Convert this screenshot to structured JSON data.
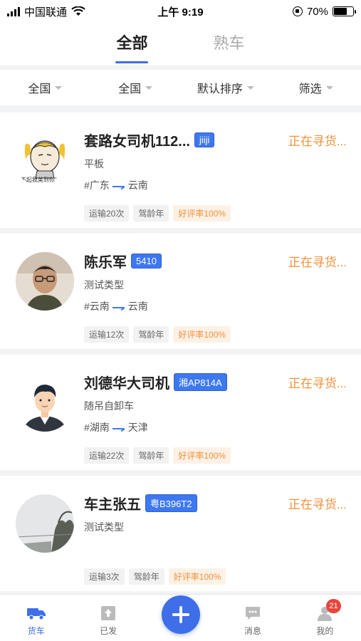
{
  "status_bar": {
    "carrier": "中国联通",
    "time": "上午 9:19",
    "battery": "70%"
  },
  "top_tabs": [
    {
      "label": "全部",
      "active": true
    },
    {
      "label": "熟车",
      "active": false
    }
  ],
  "filters": [
    {
      "label": "全国"
    },
    {
      "label": "全国"
    },
    {
      "label": "默认排序"
    },
    {
      "label": "筛选"
    }
  ],
  "drivers": [
    {
      "name": "套路女司机112...",
      "plate": "jiiji",
      "status": "正在寻货...",
      "vehicle_type": "平板",
      "route_from": "#广东",
      "route_to": "云南",
      "trips": "运输20次",
      "driving_years": "驾龄年",
      "rating": "好评率100%",
      "avatar_caption": "\"不起我美到你\""
    },
    {
      "name": "陈乐军",
      "plate": "5410",
      "status": "正在寻货...",
      "vehicle_type": "测试类型",
      "route_from": "#云南",
      "route_to": "云南",
      "trips": "运输12次",
      "driving_years": "驾龄年",
      "rating": "好评率100%"
    },
    {
      "name": "刘德华大司机",
      "plate": "湘AP814A",
      "status": "正在寻货...",
      "vehicle_type": "随吊自卸车",
      "route_from": "#湖南",
      "route_to": "天津",
      "trips": "运输22次",
      "driving_years": "驾龄年",
      "rating": "好评率100%"
    },
    {
      "name": "车主张五",
      "plate": "粤B396T2",
      "status": "正在寻货...",
      "vehicle_type": "测试类型",
      "trips": "运输3次",
      "driving_years": "驾龄年",
      "rating": "好评率100%"
    }
  ],
  "tab_bar": {
    "items": [
      {
        "label": "货车",
        "icon": "truck-icon",
        "active": true
      },
      {
        "label": "已发",
        "icon": "upload-icon",
        "active": false
      },
      {
        "label": "消息",
        "icon": "message-icon",
        "active": false
      },
      {
        "label": "我的",
        "icon": "user-icon",
        "active": false,
        "badge": "21"
      }
    ]
  },
  "colors": {
    "accent": "#3e6ee8",
    "status": "#f0913a",
    "badge": "#e8453c"
  }
}
